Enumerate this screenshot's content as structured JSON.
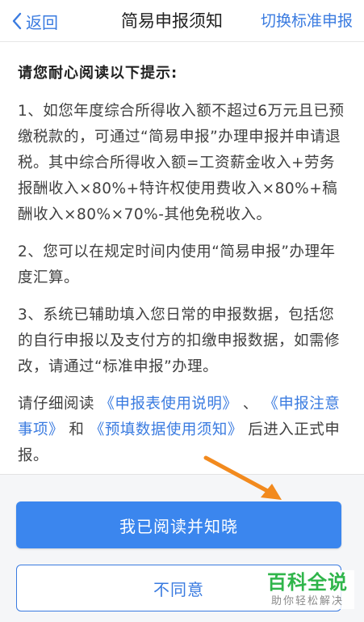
{
  "navbar": {
    "back_label": "返回",
    "title": "简易申报须知",
    "switch_label": "切换标准申报",
    "accent_color": "#3a7be0"
  },
  "notice": {
    "heading": "请您耐心阅读以下提示:",
    "p1": "1、如您年度综合所得收入额不超过6万元且已预缴税款的，可通过“简易申报”办理申报并申请退税。其中综合所得收入额=工资薪金收入+劳务报酬收入×80%+特许权使用费收入×80%+稿酬收入×80%×70%-其他免税收入。",
    "p2": "2、您可以在规定时间内使用“简易申报”办理年度汇算。",
    "p3": "3、系统已辅助填入您日常的申报数据，包括您的自行申报以及支付方的扣缴申报数据，如需修改，请通过“标准申报”办理。",
    "p4_prefix": "请仔细阅读",
    "link1": "《申报表使用说明》",
    "sep1": "、",
    "link2": "《申报注意事项》",
    "sep2": "和",
    "link3": "《预填数据使用须知》",
    "p4_suffix": "后进入正式申报。"
  },
  "actions": {
    "agree_label": "我已阅读并知晓",
    "disagree_label": "不同意",
    "primary_color": "#3b86ee"
  },
  "watermark": {
    "brand": "百科全说",
    "tagline": "助你轻松解决"
  },
  "icons": {
    "back": "chevron-left-icon",
    "annotation": "orange-arrow-icon"
  }
}
